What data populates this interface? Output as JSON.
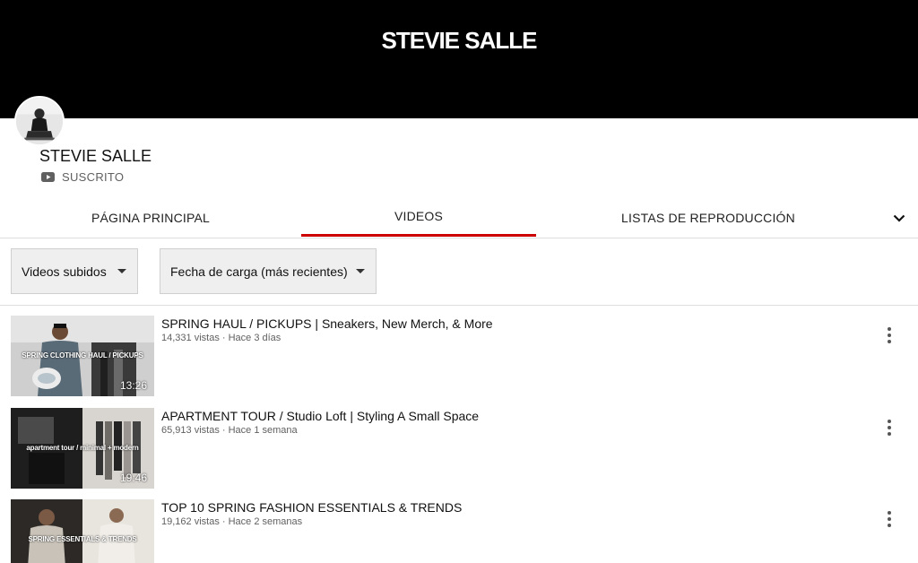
{
  "channel": {
    "banner_title": "STEVIE SALLE",
    "name": "STEVIE SALLE",
    "subscribed_label": "SUSCRITO"
  },
  "tabs": [
    {
      "label": "PÁGINA PRINCIPAL",
      "active": false
    },
    {
      "label": "VIDEOS",
      "active": true
    },
    {
      "label": "LISTAS DE REPRODUCCIÓN",
      "active": false
    }
  ],
  "filters": {
    "type": "Videos subidos",
    "sort": "Fecha de carga (más recientes)"
  },
  "videos": [
    {
      "title": "SPRING HAUL / PICKUPS | Sneakers, New Merch, & More",
      "meta": "14,331 vistas · Hace 3 días",
      "duration": "13:26",
      "overlay": "SPRING CLOTHING HAUL / PICKUPS"
    },
    {
      "title": "APARTMENT TOUR / Studio Loft | Styling A Small Space",
      "meta": "65,913 vistas · Hace 1 semana",
      "duration": "19:46",
      "overlay": "apartment tour / minimal + modern"
    },
    {
      "title": "TOP 10 SPRING FASHION ESSENTIALS & TRENDS",
      "meta": "19,162 vistas · Hace 2 semanas",
      "duration": "",
      "overlay": "SPRING ESSENTIALS & TRENDS"
    }
  ],
  "colors": {
    "accent": "#cc0000",
    "banner": "#000000",
    "filter_bg": "#efefef"
  },
  "icons": {
    "subscribed": "youtube-play-icon",
    "more_tabs": "chevron-down-icon",
    "video_menu": "more-vertical-icon"
  }
}
